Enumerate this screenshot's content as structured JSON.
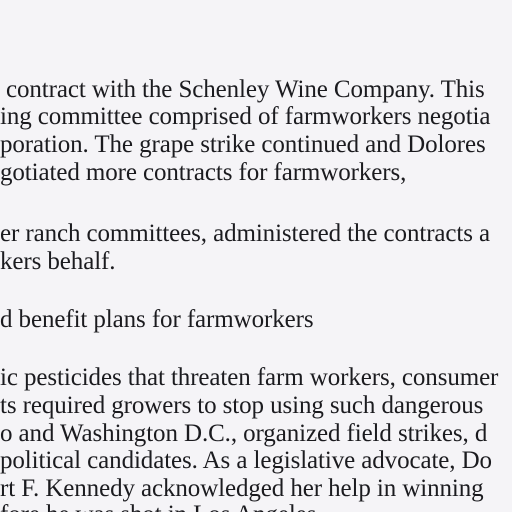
{
  "document": {
    "lines": [
      "contract with the Schenley Wine Company. This",
      "ing committee comprised of farmworkers negotia",
      "poration. The grape strike continued and Dolores",
      "gotiated more contracts for farmworkers,",
      "er ranch committees, administered the contracts a",
      "kers behalf.",
      "d benefit plans for farmworkers",
      "ic pesticides that threaten farm workers, consumer",
      "ts required growers to stop using such dangerous",
      "o and Washington D.C., organized field strikes, d",
      "political candidates. As a legislative advocate, Do",
      "rt F. Kennedy acknowledged her help in winning",
      "fore he was shot in Los Angeles."
    ]
  }
}
